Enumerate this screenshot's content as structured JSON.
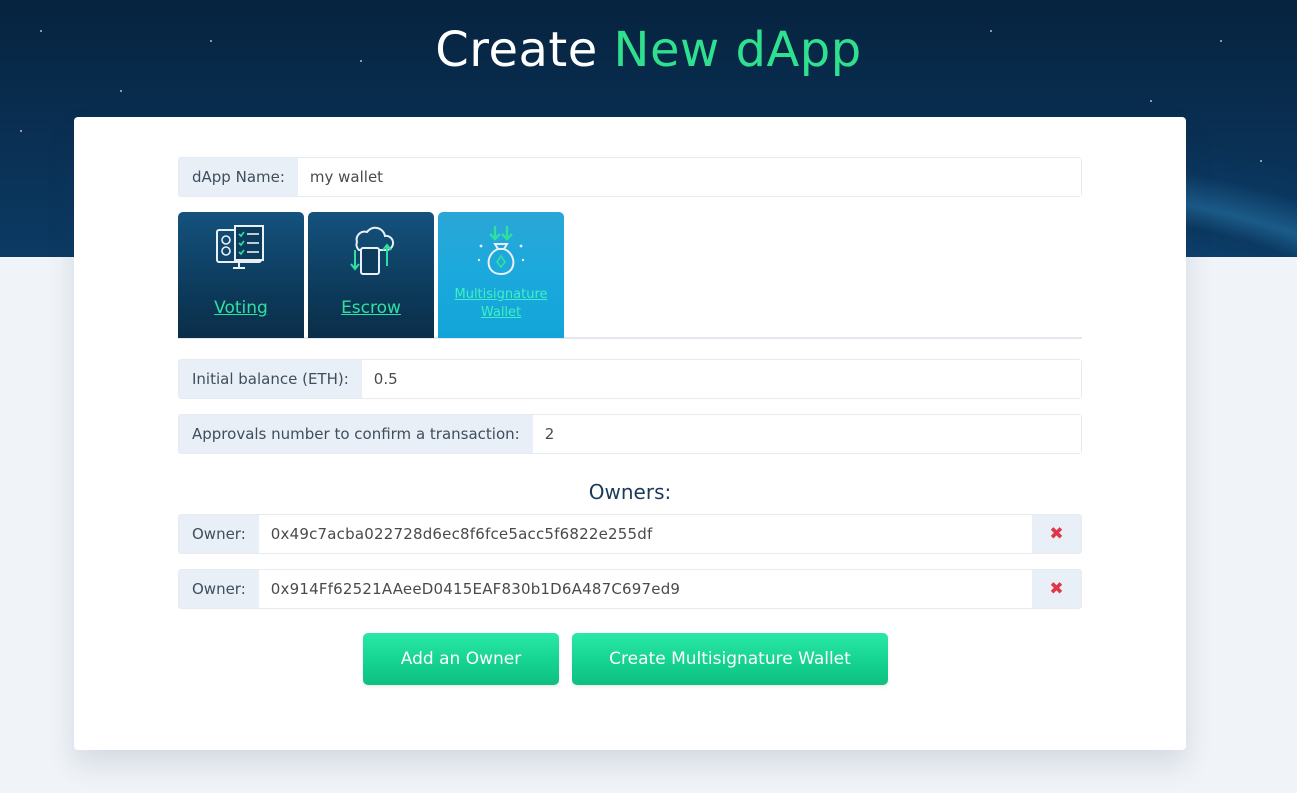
{
  "header": {
    "title_plain": "Create",
    "title_accent": "New dApp"
  },
  "form": {
    "dapp_name_label": "dApp Name:",
    "dapp_name_value": "my wallet",
    "tabs": [
      {
        "label": "Voting",
        "icon": "voting-monitor-icon"
      },
      {
        "label": "Escrow",
        "icon": "escrow-exchange-icon"
      },
      {
        "label": "Multisignature Wallet",
        "label_line1": "Multisignature",
        "label_line2": "Wallet",
        "icon": "money-bag-icon",
        "active": true
      }
    ],
    "initial_balance_label": "Initial balance (ETH):",
    "initial_balance_value": "0.5",
    "approvals_label": "Approvals number to confirm a transaction:",
    "approvals_value": "2",
    "owners_heading": "Owners:",
    "owners": [
      {
        "label": "Owner:",
        "address": "0x49c7acba022728d6ec8f6fce5acc5f6822e255df"
      },
      {
        "label": "Owner:",
        "address": "0x914Ff62521AAeeD0415EAF830b1D6A487C697ed9"
      }
    ],
    "remove_glyph": "✖",
    "add_owner_button": "Add an Owner",
    "create_button": "Create Multisignature Wallet"
  },
  "colors": {
    "accent_green": "#2fe08f",
    "tab_dark": "#0d3b5c",
    "tab_active": "#1ba9dd",
    "remove_red": "#e0364a",
    "button_green": "#14d18f"
  }
}
